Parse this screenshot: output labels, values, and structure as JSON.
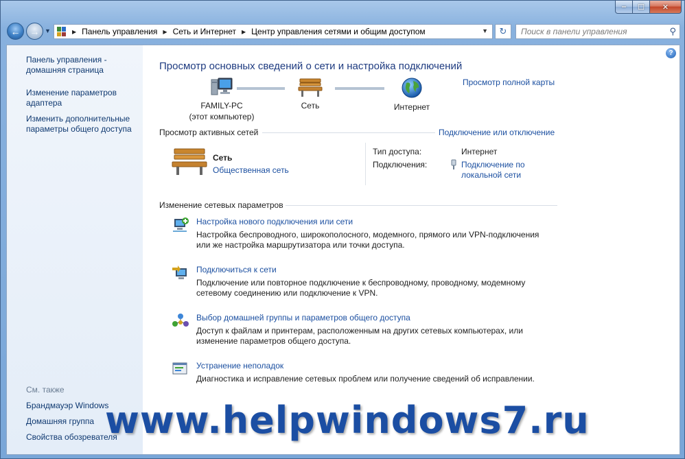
{
  "window": {
    "controls": {
      "minimize": "‒",
      "maximize": "☐",
      "close": "✕"
    }
  },
  "nav": {
    "back_glyph": "←",
    "forward_glyph": "→",
    "breadcrumbs": [
      "Панель управления",
      "Сеть и Интернет",
      "Центр управления сетями и общим доступом"
    ],
    "search_placeholder": "Поиск в панели управления"
  },
  "sidebar": {
    "links": [
      {
        "line1": "Панель управления -",
        "line2": "домашняя страница"
      },
      {
        "line1": "Изменение параметров",
        "line2": "адаптера"
      },
      {
        "line1": "Изменить дополнительные",
        "line2": "параметры общего доступа"
      }
    ],
    "see_also_label": "См. также",
    "see_also": [
      "Брандмауэр Windows",
      "Домашняя группа",
      "Свойства обозревателя"
    ]
  },
  "main": {
    "title": "Просмотр основных сведений о сети и настройка подключений",
    "full_map_link": "Просмотр полной карты",
    "map": {
      "computer_name": "FAMILY-PC",
      "computer_sub": "(этот компьютер)",
      "network": "Сеть",
      "internet": "Интернет"
    },
    "active_networks": {
      "section_title": "Просмотр активных сетей",
      "connect_link": "Подключение или отключение",
      "network_name": "Сеть",
      "network_type": "Общественная сеть",
      "access_type_label": "Тип доступа:",
      "access_type_value": "Интернет",
      "connections_label": "Подключения:",
      "connection_line1": "Подключение по",
      "connection_line2": "локальной сети"
    },
    "change_settings": {
      "section_title": "Изменение сетевых параметров",
      "tasks": [
        {
          "link": "Настройка нового подключения или сети",
          "desc1": "Настройка беспроводного, широкополосного, модемного, прямого или VPN-подключения",
          "desc2": "или же настройка маршрутизатора или точки доступа."
        },
        {
          "link": "Подключиться к сети",
          "desc1": "Подключение или повторное подключение к беспроводному, проводному, модемному",
          "desc2": "сетевому соединению или подключение к VPN."
        },
        {
          "link": "Выбор домашней группы и параметров общего доступа",
          "desc1": "Доступ к файлам и принтерам, расположенным на других сетевых компьютерах, или",
          "desc2": "изменение параметров общего доступа."
        },
        {
          "link": "Устранение неполадок",
          "desc1": "Диагностика и исправление сетевых проблем или получение сведений об исправлении.",
          "desc2": ""
        }
      ]
    }
  },
  "watermark": "www.helpwindows7.ru",
  "colors": {
    "link": "#1b4fa0",
    "title": "#1e3b80",
    "sidebar_link": "#0f3970"
  }
}
